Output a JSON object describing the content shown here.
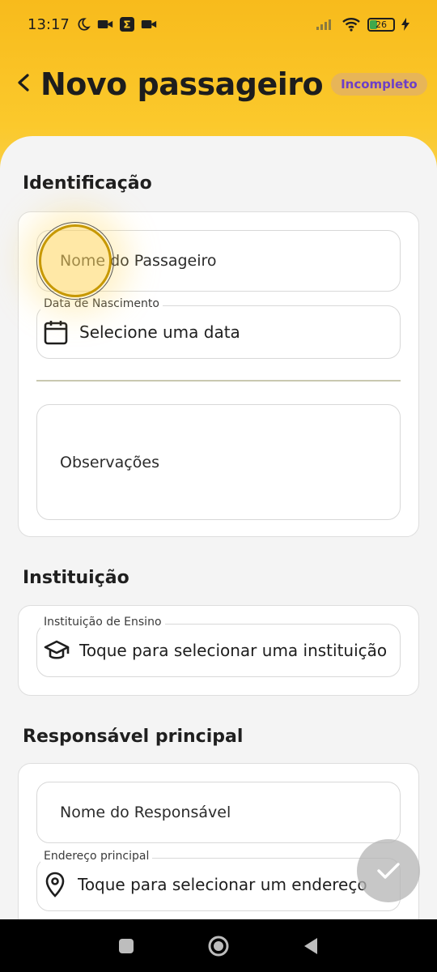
{
  "status_bar": {
    "time": "13:17",
    "battery": "26"
  },
  "header": {
    "title": "Novo passageiro",
    "badge": "Incompleto"
  },
  "identificacao": {
    "section_title": "Identificação",
    "name_placeholder": "Nome do Passageiro",
    "birth_label": "Data de Nascimento",
    "birth_value": "Selecione uma data",
    "notes_placeholder": "Observações"
  },
  "instituicao": {
    "section_title": "Instituição",
    "field_label": "Instituição de Ensino",
    "field_value": "Toque para selecionar uma instituição"
  },
  "responsavel": {
    "section_title": "Responsável principal",
    "name_placeholder": "Nome do Responsável",
    "address_label": "Endereço principal",
    "address_value": "Toque para selecionar um endereço"
  },
  "colors": {
    "header_yellow": "#fbc92c",
    "badge_bg": "#e7b558",
    "badge_text": "#6d3fc7"
  },
  "icons": [
    "moon-icon",
    "video-icon",
    "sigma-app-icon",
    "signal-icon",
    "wifi-icon",
    "battery-icon",
    "charging-icon",
    "back-arrow-icon",
    "calendar-icon",
    "graduation-cap-icon",
    "location-pin-icon",
    "check-icon"
  ]
}
